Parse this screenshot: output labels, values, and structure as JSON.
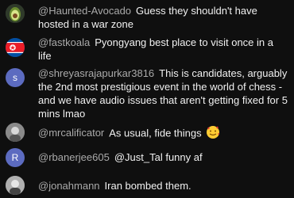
{
  "messages": [
    {
      "author": "@Haunted-Avocado",
      "text": "Guess they shouldn't have hosted in a war zone",
      "avatar": "avocado-avatar"
    },
    {
      "author": "@fastkoala",
      "text": "Pyongyang best place to visit once in a life",
      "avatar": "north-korea-flag-avatar"
    },
    {
      "author": "@shreyasrajapurkar3816",
      "text": "This is candidates, arguably the 2nd most prestigious event in the world of chess - and we have audio issues that aren't getting fixed for 5 mins lmao",
      "avatar": "letter-s-avatar",
      "avatar_letter": "S",
      "avatar_color": "#5c6bc0"
    },
    {
      "author": "@mrcalificator",
      "text": "As usual, fide things",
      "avatar": "photo-avatar",
      "emoji": "smiling-face-with-hearts"
    },
    {
      "author": "@rbanerjee605",
      "text": "@Just_Tal funny af",
      "avatar": "letter-r-avatar",
      "avatar_letter": "R",
      "avatar_color": "#5c6bc0"
    },
    {
      "author": "@jonahmann",
      "text": "Iran bombed them.",
      "avatar": "photo-avatar"
    }
  ]
}
